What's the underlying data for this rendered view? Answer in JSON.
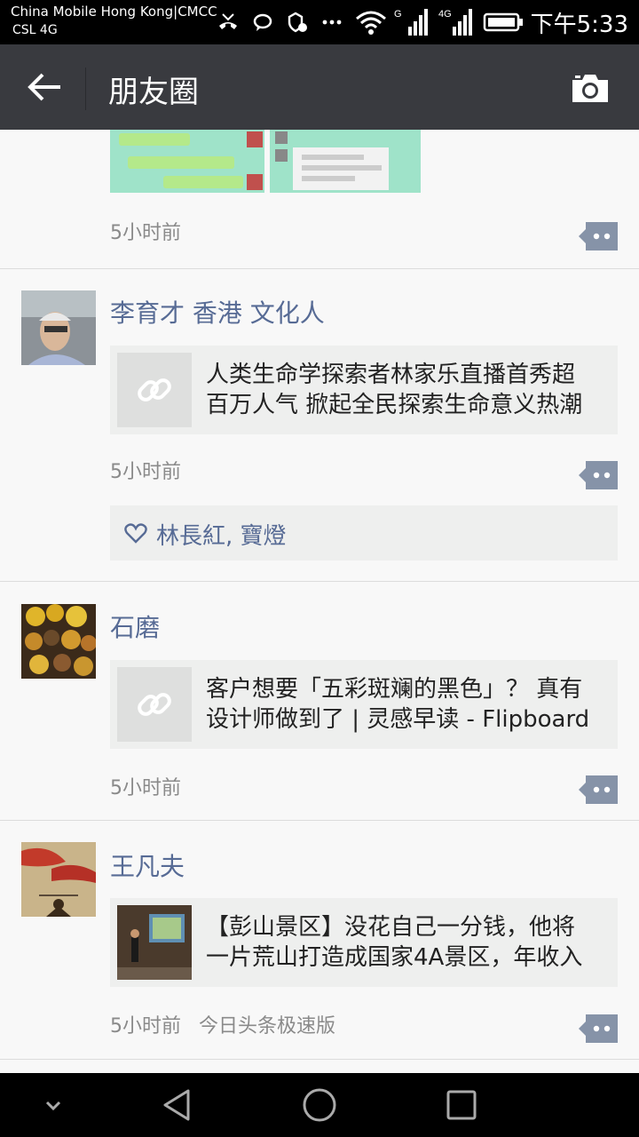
{
  "status_bar": {
    "carrier_line1": "China Mobile Hong Kong|CMCC",
    "carrier_line2": "CSL  4G",
    "net_label_1": "G",
    "net_label_2": "4G",
    "clock": "下午5:33"
  },
  "title_bar": {
    "title": "朋友圈"
  },
  "posts": [
    {
      "time": "5小时前"
    },
    {
      "author": "李育才 香港 文化人",
      "link_line1": "人类生命学探索者林家乐直播首秀超",
      "link_line2": "百万人气 掀起全民探索生命意义热潮",
      "time": "5小时前",
      "likes": "林長紅, 寶燈"
    },
    {
      "author": "石磨",
      "link_line1": "客户想要「五彩斑斓的黑色」？ 真有",
      "link_line2": "设计师做到了 | 灵感早读 - Flipboard",
      "time": "5小时前"
    },
    {
      "author": "王凡夫",
      "link_line1": "【彭山景区】没花自己一分钱，他将",
      "link_line2": "一片荒山打造成国家4A景区，年收入",
      "time": "5小时前",
      "source": "今日头条极速版"
    }
  ],
  "colors": {
    "accent_link": "#576b95",
    "title_bar": "#393a3f"
  }
}
